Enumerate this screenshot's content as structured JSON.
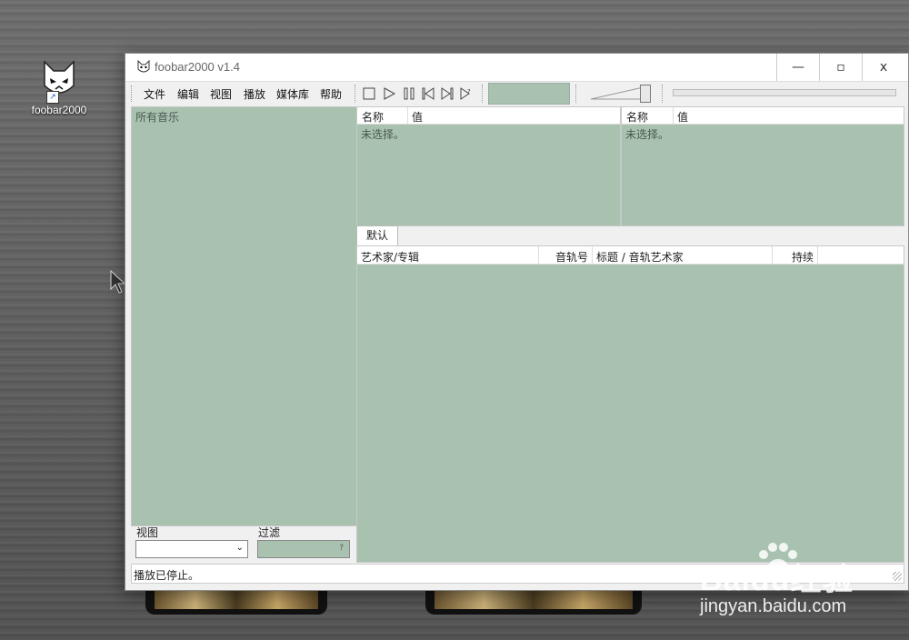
{
  "desktop": {
    "icon_label": "foobar2000"
  },
  "window": {
    "title": "foobar2000 v1.4"
  },
  "menu": [
    "文件",
    "编辑",
    "视图",
    "播放",
    "媒体库",
    "帮助"
  ],
  "library": {
    "root_label": "所有音乐",
    "view_label": "视图",
    "filter_label": "过滤",
    "filter_help": "?"
  },
  "props_left": {
    "col_name": "名称",
    "col_value": "值",
    "empty": "未选择。"
  },
  "props_right": {
    "col_name": "名称",
    "col_value": "值",
    "empty": "未选择。"
  },
  "playlist": {
    "tab": "默认",
    "columns": [
      "艺术家/专辑",
      "音轨号",
      "标题 / 音轨艺术家",
      "持续"
    ]
  },
  "status": {
    "text": "播放已停止。"
  },
  "watermark": {
    "brand": "Baidu经验",
    "url": "jingyan.baidu.com"
  },
  "colors": {
    "panel": "#a9c2b0",
    "window": "#f0f0f0"
  }
}
